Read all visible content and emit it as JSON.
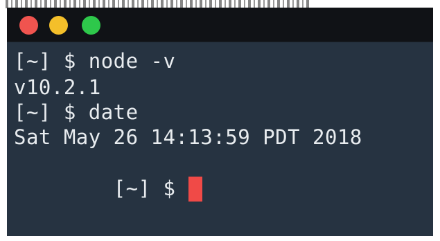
{
  "window": {
    "accent": "#263341",
    "titlebar_color": "#101216",
    "traffic_lights": [
      {
        "name": "close",
        "color": "#f0544f"
      },
      {
        "name": "minimize",
        "color": "#f4bf2a"
      },
      {
        "name": "zoom",
        "color": "#2ec84b"
      }
    ]
  },
  "terminal": {
    "lines": [
      "[~] $ node -v",
      "v10.2.1",
      "[~] $ date",
      "Sat May 26 14:13:59 PDT 2018",
      "[~] $ "
    ],
    "text_color": "#e8ecef",
    "cursor_color": "#f04a47"
  }
}
